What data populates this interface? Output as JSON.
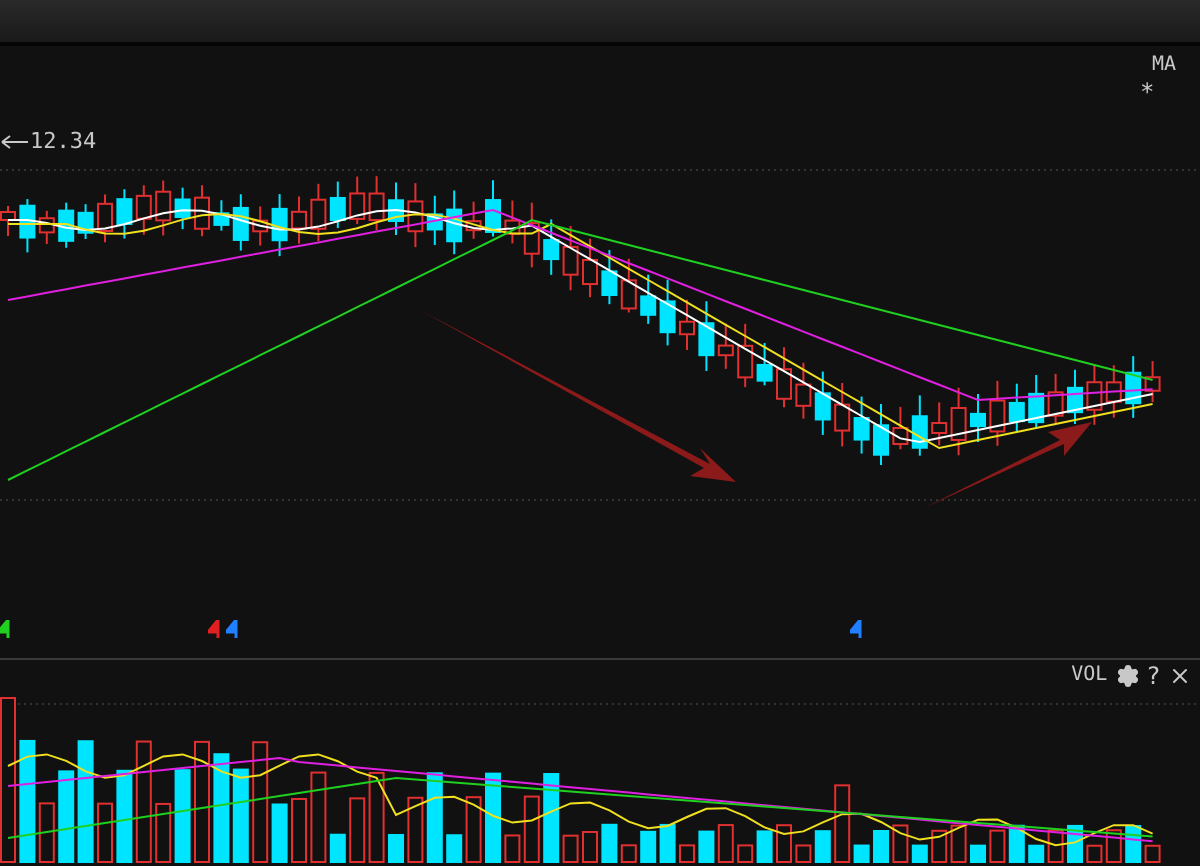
{
  "price_chart": {
    "price_label": "12.34",
    "indicator": "MA",
    "indicator_mark": "*"
  },
  "volume_panel": {
    "label": "VOL",
    "help": "?"
  }
}
